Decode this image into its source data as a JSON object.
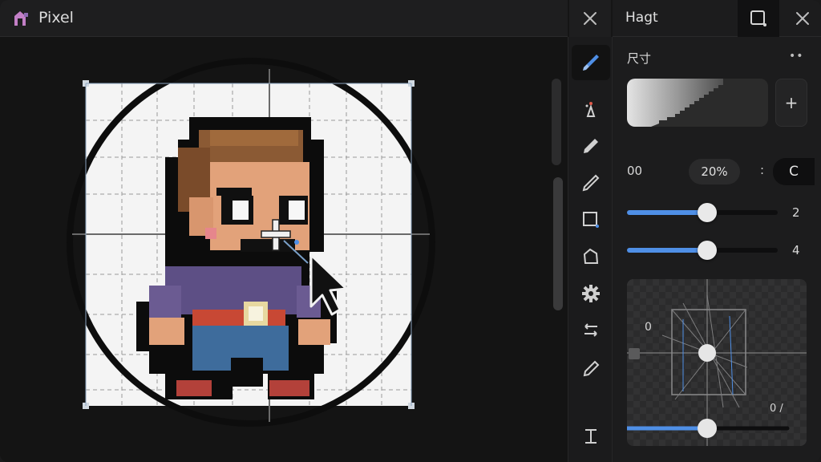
{
  "window": {
    "title": "Pixel"
  },
  "panel": {
    "title": "Hagt",
    "size_label": "尺寸",
    "more": "••",
    "add_symbol": "+",
    "field_value": "00",
    "percent": "20%",
    "colon": ":",
    "mode": "C",
    "slider1": {
      "value": "2",
      "level": 0.53
    },
    "slider2": {
      "value": "4",
      "level": 0.53
    },
    "preview": {
      "label_a": "0",
      "label_b": "0 /",
      "slider_level": 0.51
    }
  },
  "tools": [
    {
      "icon": "brush-icon",
      "active": true
    },
    {
      "icon": "spray-icon",
      "active": false
    },
    {
      "icon": "pencil-icon",
      "active": false
    },
    {
      "icon": "pen-icon",
      "active": false
    },
    {
      "icon": "select-rect-icon",
      "active": false
    },
    {
      "icon": "lasso-icon",
      "active": false
    },
    {
      "icon": "settings-gear-icon",
      "active": false
    },
    {
      "icon": "swap-icon",
      "active": false
    },
    {
      "icon": "eyedropper-icon",
      "active": false
    },
    {
      "icon": "text-tool-icon",
      "active": false
    }
  ],
  "colors": {
    "accent": "#4f8fe6",
    "canvas_bg": "#141414",
    "panel_bg": "#1c1c1d"
  }
}
